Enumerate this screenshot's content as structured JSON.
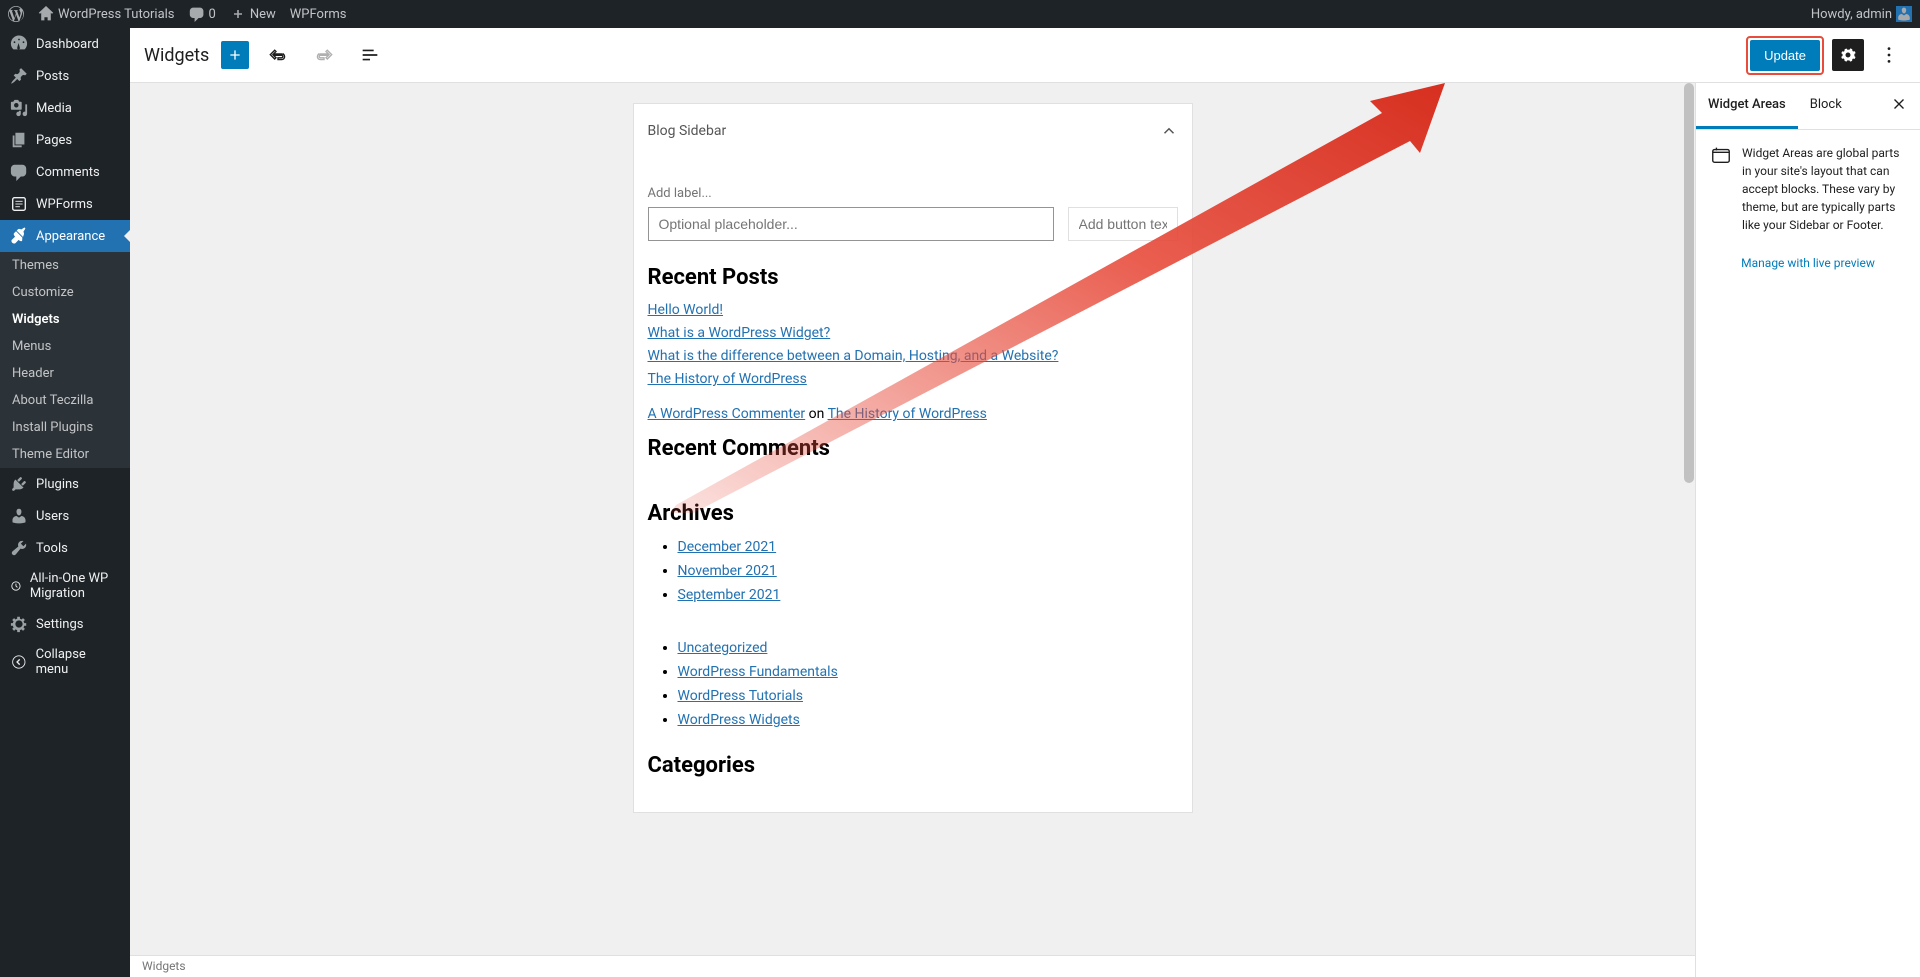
{
  "adminbar": {
    "site_title": "WordPress Tutorials",
    "comments_count": "0",
    "new": "New",
    "wpforms": "WPForms",
    "howdy": "Howdy, admin"
  },
  "sidebar": {
    "items": [
      {
        "label": "Dashboard"
      },
      {
        "label": "Posts"
      },
      {
        "label": "Media"
      },
      {
        "label": "Pages"
      },
      {
        "label": "Comments"
      },
      {
        "label": "WPForms"
      },
      {
        "label": "Appearance"
      },
      {
        "label": "Plugins"
      },
      {
        "label": "Users"
      },
      {
        "label": "Tools"
      },
      {
        "label": "All-in-One WP Migration"
      },
      {
        "label": "Settings"
      },
      {
        "label": "Collapse menu"
      }
    ],
    "appearance_sub": [
      {
        "label": "Themes"
      },
      {
        "label": "Customize"
      },
      {
        "label": "Widgets"
      },
      {
        "label": "Menus"
      },
      {
        "label": "Header"
      },
      {
        "label": "About Teczilla"
      },
      {
        "label": "Install Plugins"
      },
      {
        "label": "Theme Editor"
      }
    ]
  },
  "toolbar": {
    "title": "Widgets",
    "update": "Update"
  },
  "widget_area": {
    "title": "Blog Sidebar",
    "label_text": "Add label...",
    "placeholder": "Optional placeholder...",
    "button_placeholder": "Add button text...",
    "recent_posts_heading": "Recent Posts",
    "recent_posts": [
      "Hello World!",
      "What is a WordPress Widget?",
      "What is the difference between a Domain, Hosting, and a Website?",
      "The History of WordPress"
    ],
    "recent_comments_heading": "Recent Comments",
    "comment_author": "A WordPress Commenter",
    "comment_on": " on ",
    "comment_post": "The History of WordPress",
    "archives_heading": "Archives",
    "archives": [
      "December 2021",
      "November 2021",
      "September 2021"
    ],
    "categories_heading": "Categories",
    "categories": [
      "Uncategorized",
      "WordPress Fundamentals",
      "WordPress Tutorials",
      "WordPress Widgets"
    ]
  },
  "right_panel": {
    "tab_widget_areas": "Widget Areas",
    "tab_block": "Block",
    "desc": "Widget Areas are global parts in your site's layout that can accept blocks. These vary by theme, but are typically parts like your Sidebar or Footer.",
    "manage_link": "Manage with live preview"
  },
  "footer": {
    "crumb": "Widgets"
  }
}
